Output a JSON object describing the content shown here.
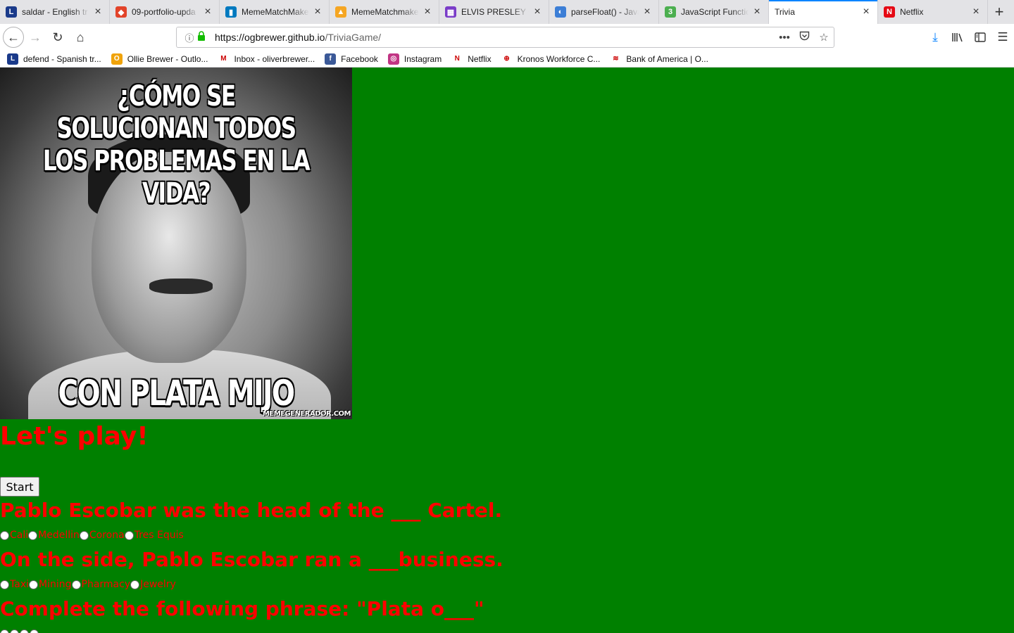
{
  "browser": {
    "tabs": [
      {
        "title": "saldar - English tr",
        "icon": "lexicon-icon",
        "color": "#1a3a8a",
        "glyph": "L",
        "active": false
      },
      {
        "title": "09-portfolio-upda",
        "icon": "gitlab-icon",
        "color": "#e24329",
        "glyph": "◆",
        "active": false
      },
      {
        "title": "MemeMatchMaker",
        "icon": "trello-icon",
        "color": "#0079bf",
        "glyph": "▮",
        "active": false
      },
      {
        "title": "MemeMatchmaker",
        "icon": "firebase-icon",
        "color": "#f5a623",
        "glyph": "▲",
        "active": false
      },
      {
        "title": "ELVIS PRESLEY ~",
        "icon": "tv-icon",
        "color": "#7a3cc8",
        "glyph": "▦",
        "active": false
      },
      {
        "title": "parseFloat() - Java",
        "icon": "mdn-icon",
        "color": "#3c7ed6",
        "glyph": "◐",
        "active": false
      },
      {
        "title": "JavaScript Functio",
        "icon": "w3schools-icon",
        "color": "#4caf50",
        "glyph": "3",
        "active": false
      },
      {
        "title": "Trivia",
        "icon": "",
        "color": "",
        "glyph": "",
        "active": true
      },
      {
        "title": "Netflix",
        "icon": "netflix-icon",
        "color": "#e50914",
        "glyph": "N",
        "active": false
      }
    ],
    "url": {
      "host": "https://ogbrewer.github.io",
      "path": "/TriviaGame/"
    },
    "bookmarks": [
      {
        "label": "defend - Spanish tr...",
        "icon": "lexicon-icon",
        "color": "#1a3a8a",
        "glyph": "L"
      },
      {
        "label": "Ollie Brewer - Outlo...",
        "icon": "outlook-icon",
        "color": "#f0a30a",
        "glyph": "O"
      },
      {
        "label": "Inbox - oliverbrewer...",
        "icon": "gmail-icon",
        "color": "#ffffff",
        "glyph": "M"
      },
      {
        "label": "Facebook",
        "icon": "facebook-icon",
        "color": "#3b5998",
        "glyph": "f"
      },
      {
        "label": "Instagram",
        "icon": "instagram-icon",
        "color": "#c13584",
        "glyph": "◎"
      },
      {
        "label": "Netflix",
        "icon": "netflix-icon",
        "color": "#ffffff",
        "glyph": "N"
      },
      {
        "label": "Kronos Workforce C...",
        "icon": "globe-icon",
        "color": "#ffffff",
        "glyph": "⊕"
      },
      {
        "label": "Bank of America | O...",
        "icon": "bofa-icon",
        "color": "#ffffff",
        "glyph": "≋"
      }
    ]
  },
  "page": {
    "background": "#008000",
    "text_color": "#ff0000",
    "meme": {
      "top_text": "¿CÓMO SE SOLUCIONAN TODOS LOS PROBLEMAS EN LA VIDA?",
      "bottom_text": "CON PLATA MIJO",
      "watermark": "MEMEGENERADOR.COM"
    },
    "heading": "Let's play!",
    "start_label": "Start",
    "questions": [
      {
        "text": "Pablo Escobar was the head of the ___ Cartel.",
        "options": [
          "Cali",
          "Medellin",
          "Corona",
          "Tres Equis"
        ]
      },
      {
        "text": "On the side, Pablo Escobar ran a ___business.",
        "options": [
          "Taxi",
          "Mining",
          "Pharmacy",
          "Jewelry"
        ]
      },
      {
        "text": "Complete the following phrase: \"Plata o___\"",
        "options": [
          "",
          "",
          "",
          ""
        ]
      }
    ]
  }
}
